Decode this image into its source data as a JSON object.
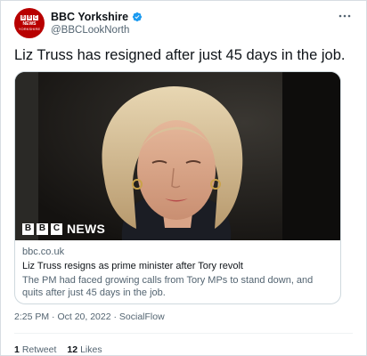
{
  "account": {
    "display_name": "BBC Yorkshire",
    "handle": "@BBCLookNorth",
    "avatar": {
      "blocks": [
        "B",
        "B",
        "C"
      ],
      "news": "NEWS",
      "region": "YORKSHIRE"
    }
  },
  "tweet": {
    "text": "Liz Truss has resigned after just 45 days in the job."
  },
  "card": {
    "logo_blocks": [
      "B",
      "B",
      "C"
    ],
    "logo_news": "NEWS",
    "domain": "bbc.co.uk",
    "title": "Liz Truss resigns as prime minister after Tory revolt",
    "description": "The PM had faced growing calls from Tory MPs to stand down, and quits after just 45 days in the job."
  },
  "meta": {
    "time": "2:25 PM",
    "separator": "·",
    "date": "Oct 20, 2022",
    "source": "SocialFlow"
  },
  "stats": {
    "retweets_count": "1",
    "retweets_label": "Retweet",
    "likes_count": "12",
    "likes_label": "Likes"
  },
  "icons": {
    "verified": "verified-badge-icon",
    "more": "more-options-icon"
  },
  "colors": {
    "bbc_red": "#b80000",
    "verified_blue": "#1d9bf0",
    "muted": "#536471"
  }
}
